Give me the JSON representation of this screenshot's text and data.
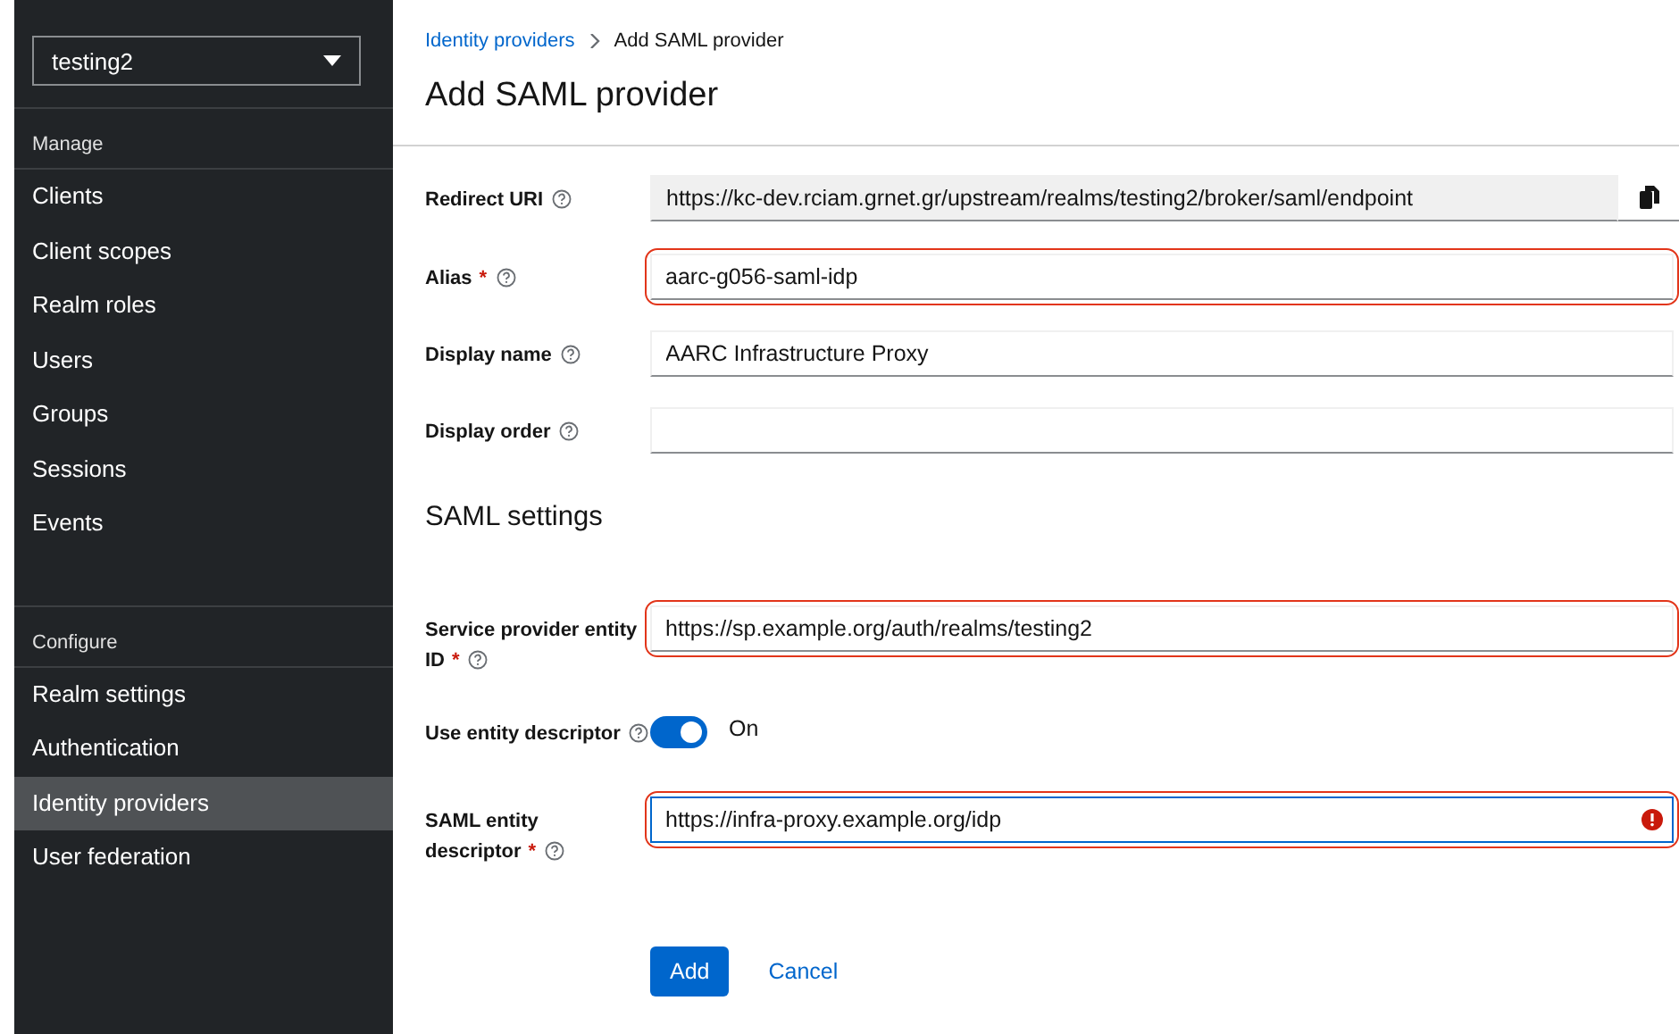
{
  "sidebar": {
    "realm_selector": "testing2",
    "sections": [
      {
        "heading": "Manage",
        "items": [
          {
            "label": "Clients",
            "selected": false
          },
          {
            "label": "Client scopes",
            "selected": false
          },
          {
            "label": "Realm roles",
            "selected": false
          },
          {
            "label": "Users",
            "selected": false
          },
          {
            "label": "Groups",
            "selected": false
          },
          {
            "label": "Sessions",
            "selected": false
          },
          {
            "label": "Events",
            "selected": false
          }
        ]
      },
      {
        "heading": "Configure",
        "items": [
          {
            "label": "Realm settings",
            "selected": false
          },
          {
            "label": "Authentication",
            "selected": false
          },
          {
            "label": "Identity providers",
            "selected": true
          },
          {
            "label": "User federation",
            "selected": false
          }
        ]
      }
    ]
  },
  "breadcrumb": {
    "link": "Identity providers",
    "current": "Add SAML provider"
  },
  "page_title": "Add SAML provider",
  "general_fields": [
    {
      "kind": "readonly",
      "label": "Redirect URI",
      "value": "https://kc-dev.rciam.grnet.gr/upstream/realms/testing2/broker/saml/endpoint"
    },
    {
      "kind": "text",
      "label": "Alias",
      "required_mark": "*",
      "value": "aarc-g056-saml-idp",
      "highlighted": true,
      "error": false
    },
    {
      "kind": "text",
      "label": "Display name",
      "value": "AARC Infrastructure Proxy",
      "highlighted": false,
      "error": false
    },
    {
      "kind": "text",
      "label": "Display order",
      "highlighted": false,
      "error": false
    }
  ],
  "saml_settings": {
    "heading": "SAML settings",
    "fields": [
      {
        "kind": "text",
        "label": "Service provider entity ID",
        "required_mark": "*",
        "value": "https://sp.example.org/auth/realms/testing2",
        "highlighted": true,
        "error": false
      },
      {
        "kind": "toggle",
        "label": "Use entity descriptor",
        "on": true,
        "state_label": "On"
      },
      {
        "kind": "text",
        "label": "SAML entity descriptor",
        "required_mark": "*",
        "value": "https://infra-proxy.example.org/idp",
        "highlighted": true,
        "error": true
      }
    ]
  },
  "buttons": {
    "primary": "Add",
    "secondary": "Cancel"
  }
}
